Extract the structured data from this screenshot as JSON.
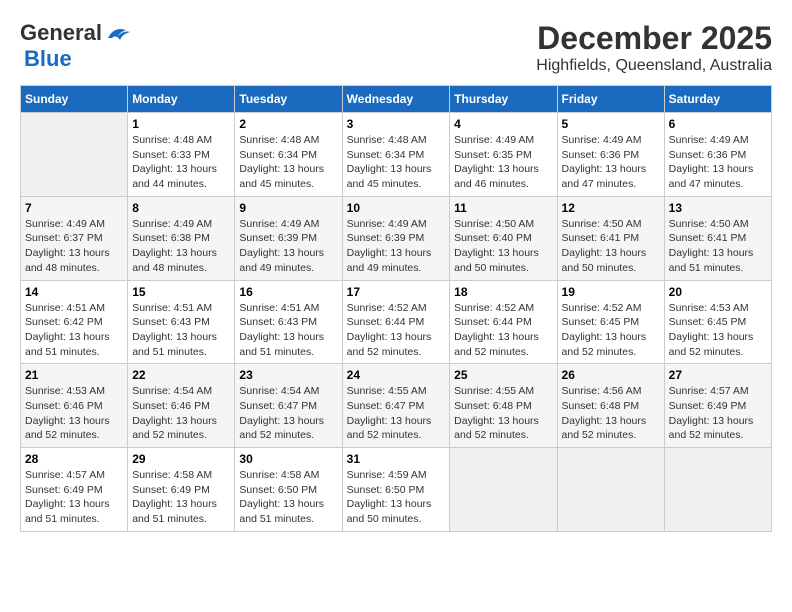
{
  "header": {
    "logo_line1": "General",
    "logo_line2": "Blue",
    "title": "December 2025",
    "subtitle": "Highfields, Queensland, Australia"
  },
  "calendar": {
    "days_of_week": [
      "Sunday",
      "Monday",
      "Tuesday",
      "Wednesday",
      "Thursday",
      "Friday",
      "Saturday"
    ],
    "weeks": [
      [
        {
          "day": "",
          "info": ""
        },
        {
          "day": "1",
          "info": "Sunrise: 4:48 AM\nSunset: 6:33 PM\nDaylight: 13 hours\nand 44 minutes."
        },
        {
          "day": "2",
          "info": "Sunrise: 4:48 AM\nSunset: 6:34 PM\nDaylight: 13 hours\nand 45 minutes."
        },
        {
          "day": "3",
          "info": "Sunrise: 4:48 AM\nSunset: 6:34 PM\nDaylight: 13 hours\nand 45 minutes."
        },
        {
          "day": "4",
          "info": "Sunrise: 4:49 AM\nSunset: 6:35 PM\nDaylight: 13 hours\nand 46 minutes."
        },
        {
          "day": "5",
          "info": "Sunrise: 4:49 AM\nSunset: 6:36 PM\nDaylight: 13 hours\nand 47 minutes."
        },
        {
          "day": "6",
          "info": "Sunrise: 4:49 AM\nSunset: 6:36 PM\nDaylight: 13 hours\nand 47 minutes."
        }
      ],
      [
        {
          "day": "7",
          "info": "Sunrise: 4:49 AM\nSunset: 6:37 PM\nDaylight: 13 hours\nand 48 minutes."
        },
        {
          "day": "8",
          "info": "Sunrise: 4:49 AM\nSunset: 6:38 PM\nDaylight: 13 hours\nand 48 minutes."
        },
        {
          "day": "9",
          "info": "Sunrise: 4:49 AM\nSunset: 6:39 PM\nDaylight: 13 hours\nand 49 minutes."
        },
        {
          "day": "10",
          "info": "Sunrise: 4:49 AM\nSunset: 6:39 PM\nDaylight: 13 hours\nand 49 minutes."
        },
        {
          "day": "11",
          "info": "Sunrise: 4:50 AM\nSunset: 6:40 PM\nDaylight: 13 hours\nand 50 minutes."
        },
        {
          "day": "12",
          "info": "Sunrise: 4:50 AM\nSunset: 6:41 PM\nDaylight: 13 hours\nand 50 minutes."
        },
        {
          "day": "13",
          "info": "Sunrise: 4:50 AM\nSunset: 6:41 PM\nDaylight: 13 hours\nand 51 minutes."
        }
      ],
      [
        {
          "day": "14",
          "info": "Sunrise: 4:51 AM\nSunset: 6:42 PM\nDaylight: 13 hours\nand 51 minutes."
        },
        {
          "day": "15",
          "info": "Sunrise: 4:51 AM\nSunset: 6:43 PM\nDaylight: 13 hours\nand 51 minutes."
        },
        {
          "day": "16",
          "info": "Sunrise: 4:51 AM\nSunset: 6:43 PM\nDaylight: 13 hours\nand 51 minutes."
        },
        {
          "day": "17",
          "info": "Sunrise: 4:52 AM\nSunset: 6:44 PM\nDaylight: 13 hours\nand 52 minutes."
        },
        {
          "day": "18",
          "info": "Sunrise: 4:52 AM\nSunset: 6:44 PM\nDaylight: 13 hours\nand 52 minutes."
        },
        {
          "day": "19",
          "info": "Sunrise: 4:52 AM\nSunset: 6:45 PM\nDaylight: 13 hours\nand 52 minutes."
        },
        {
          "day": "20",
          "info": "Sunrise: 4:53 AM\nSunset: 6:45 PM\nDaylight: 13 hours\nand 52 minutes."
        }
      ],
      [
        {
          "day": "21",
          "info": "Sunrise: 4:53 AM\nSunset: 6:46 PM\nDaylight: 13 hours\nand 52 minutes."
        },
        {
          "day": "22",
          "info": "Sunrise: 4:54 AM\nSunset: 6:46 PM\nDaylight: 13 hours\nand 52 minutes."
        },
        {
          "day": "23",
          "info": "Sunrise: 4:54 AM\nSunset: 6:47 PM\nDaylight: 13 hours\nand 52 minutes."
        },
        {
          "day": "24",
          "info": "Sunrise: 4:55 AM\nSunset: 6:47 PM\nDaylight: 13 hours\nand 52 minutes."
        },
        {
          "day": "25",
          "info": "Sunrise: 4:55 AM\nSunset: 6:48 PM\nDaylight: 13 hours\nand 52 minutes."
        },
        {
          "day": "26",
          "info": "Sunrise: 4:56 AM\nSunset: 6:48 PM\nDaylight: 13 hours\nand 52 minutes."
        },
        {
          "day": "27",
          "info": "Sunrise: 4:57 AM\nSunset: 6:49 PM\nDaylight: 13 hours\nand 52 minutes."
        }
      ],
      [
        {
          "day": "28",
          "info": "Sunrise: 4:57 AM\nSunset: 6:49 PM\nDaylight: 13 hours\nand 51 minutes."
        },
        {
          "day": "29",
          "info": "Sunrise: 4:58 AM\nSunset: 6:49 PM\nDaylight: 13 hours\nand 51 minutes."
        },
        {
          "day": "30",
          "info": "Sunrise: 4:58 AM\nSunset: 6:50 PM\nDaylight: 13 hours\nand 51 minutes."
        },
        {
          "day": "31",
          "info": "Sunrise: 4:59 AM\nSunset: 6:50 PM\nDaylight: 13 hours\nand 50 minutes."
        },
        {
          "day": "",
          "info": ""
        },
        {
          "day": "",
          "info": ""
        },
        {
          "day": "",
          "info": ""
        }
      ]
    ]
  }
}
